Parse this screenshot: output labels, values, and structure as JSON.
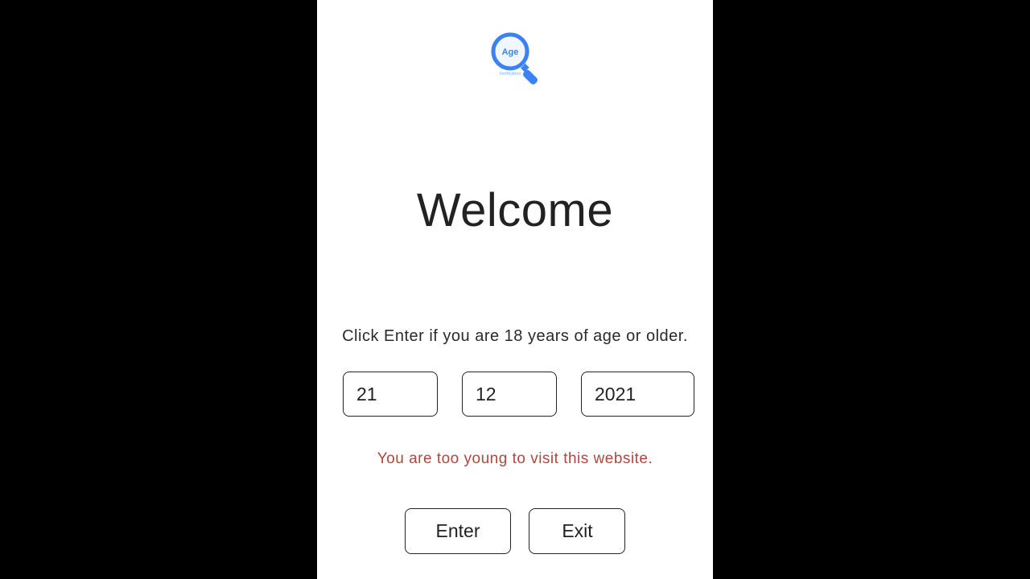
{
  "logo": {
    "text_top": "Age",
    "text_bottom": "Verification"
  },
  "title": "Welcome",
  "instruction": "Click Enter if you are 18 years of age or older.",
  "date": {
    "day": "21",
    "month": "12",
    "year": "2021"
  },
  "error_message": "You are too young to visit this website.",
  "buttons": {
    "enter": "Enter",
    "exit": "Exit"
  }
}
